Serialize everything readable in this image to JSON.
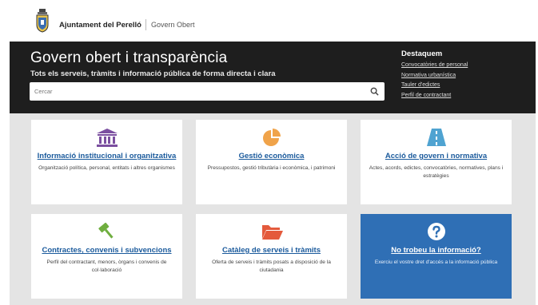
{
  "header": {
    "org_name": "Ajuntament del Perelló",
    "portal_name": "Govern Obert"
  },
  "hero": {
    "title": "Govern obert i transparència",
    "subtitle": "Tots els serveis, tràmits i informació pública de forma directa i clara",
    "search": {
      "placeholder": "Cercar",
      "value": ""
    }
  },
  "featured": {
    "title": "Destaquem",
    "links": [
      {
        "label": "Convocatòries de personal"
      },
      {
        "label": "Normativa urbanística"
      },
      {
        "label": "Tauler d'edictes"
      },
      {
        "label": "Perfil de contractant"
      }
    ]
  },
  "cards": [
    {
      "title": "Informació institucional i organitzativa",
      "description": "Organització política, personal, entitats i altres organismes",
      "icon": "institution-icon",
      "color": "#7b4fa0"
    },
    {
      "title": "Gestió econòmica",
      "description": "Pressupostos, gestió tributària i econòmica, i patrimoni",
      "icon": "pie-chart-icon",
      "color": "#f0a34a"
    },
    {
      "title": "Acció de govern i normativa",
      "description": "Actes, acords, edictes, convocatòries, normatives, plans i estratègies",
      "icon": "road-icon",
      "color": "#4fa3d1"
    },
    {
      "title": "Contractes, convenis i subvencions",
      "description": "Perfil del contractant, menors, òrgans i convenis de col·laboració",
      "icon": "gavel-icon",
      "color": "#6fae3f"
    },
    {
      "title": "Catàleg de serveis i tràmits",
      "description": "Oferta de serveis i tràmits posats a disposició de la ciutadania",
      "icon": "folder-open-icon",
      "color": "#e45a3c"
    },
    {
      "title": "No trobeu la informació?",
      "description": "Exerciu el vostre dret d'accés a la informació pública",
      "icon": "question-circle-icon",
      "color": "#2f6fb5"
    }
  ]
}
